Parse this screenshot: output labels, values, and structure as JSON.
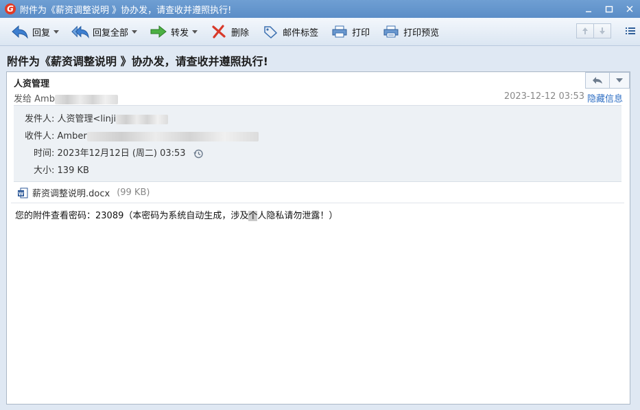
{
  "window": {
    "title": "附件为《薪资调整说明 》协办发，请查收并遵照执行!"
  },
  "toolbar": {
    "reply": "回复",
    "reply_all": "回复全部",
    "forward": "转发",
    "delete": "删除",
    "tag": "邮件标签",
    "print": "打印",
    "print_preview": "打印预览"
  },
  "message": {
    "subject": "附件为《薪资调整说明 》协办发，请查收并遵照执行!",
    "from_name": "人资管理",
    "sent_to_prefix": "发给 Amb",
    "date": "2023-12-12 03:53",
    "hide_info": "隐藏信息",
    "details": {
      "sender_label": "发件人:",
      "sender_value": "人资管理<linji",
      "recipient_label": "收件人:",
      "recipient_value": "Amber",
      "time_label": "时间:",
      "time_value": "2023年12月12日 (周二) 03:53",
      "size_label": "大小:",
      "size_value": "139 KB"
    },
    "attachment": {
      "name": "薪资调整说明.docx",
      "size": "(99 KB)"
    },
    "body_pre": "您的附件查看密码：23089（本密码为系统自动生成，涉及",
    "body_hl": "个",
    "body_post": "人隐私请勿泄露！）"
  },
  "colors": {
    "titlebar": "#5b8dc7",
    "link": "#2f6fc4",
    "background": "#dfe8f3"
  },
  "icons": [
    "app-logo-icon",
    "minimize-icon",
    "maximize-icon",
    "close-icon",
    "reply-icon",
    "reply-all-icon",
    "forward-icon",
    "delete-icon",
    "tag-icon",
    "print-icon",
    "print-preview-icon",
    "previous-icon",
    "next-icon",
    "list-view-icon",
    "history-icon",
    "word-doc-icon"
  ]
}
